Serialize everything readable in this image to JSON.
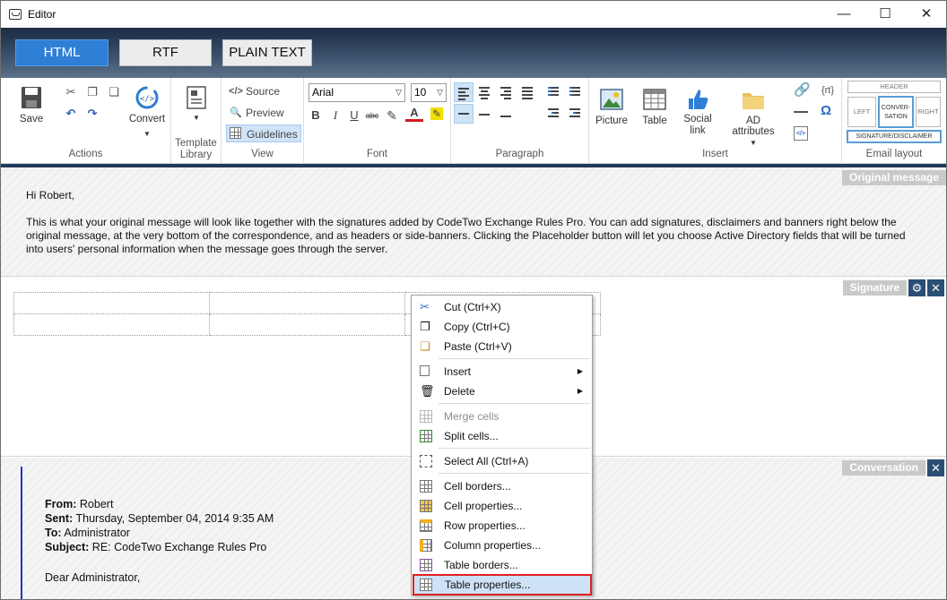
{
  "window": {
    "title": "Editor",
    "minimize": "—",
    "maximize": "☐",
    "close": "✕"
  },
  "mode_tabs": [
    {
      "label": "HTML",
      "active": true
    },
    {
      "label": "RTF",
      "active": false
    },
    {
      "label": "PLAIN TEXT",
      "active": false
    }
  ],
  "ribbon": {
    "actions": {
      "save": "Save",
      "convert": "Convert",
      "group": "Actions"
    },
    "template": {
      "group": "Template Library"
    },
    "view": {
      "source": "Source",
      "preview": "Preview",
      "guidelines": "Guidelines",
      "group": "View"
    },
    "font": {
      "family": "Arial",
      "size": "10",
      "group": "Font"
    },
    "paragraph": {
      "group": "Paragraph"
    },
    "insert": {
      "picture": "Picture",
      "table": "Table",
      "social_link": "Social link",
      "ad_attributes": "AD attributes",
      "rt": "{rt}",
      "omega": "Ω",
      "group": "Insert"
    },
    "email_layout": {
      "header": "HEADER",
      "left": "LEFT",
      "conversation": "CONVER-SATION",
      "right": "RIGHT",
      "signature": "SIGNATURE/DISCLAIMER",
      "group": "Email layout"
    }
  },
  "sections": {
    "original": {
      "tag": "Original message",
      "greeting": "Hi Robert,",
      "body": "This is what your original message will look like together with the signatures added by CodeTwo Exchange Rules Pro. You can add signatures, disclaimers and banners right below the original message, at the very bottom of the correspondence, and as headers or side-banners. Clicking the Placeholder button will let you choose Active Directory fields that will be turned into users' personal information when the message goes through the server."
    },
    "signature": {
      "tag": "Signature"
    },
    "conversation": {
      "tag": "Conversation",
      "from_label": "From:",
      "from": "Robert",
      "sent_label": "Sent:",
      "sent": "Thursday, September 04, 2014 9:35 AM",
      "to_label": "To:",
      "to": "Administrator",
      "subject_label": "Subject:",
      "subject": "RE: CodeTwo Exchange Rules Pro",
      "salutation": "Dear Administrator,"
    }
  },
  "context_menu": {
    "cut": "Cut (Ctrl+X)",
    "copy": "Copy (Ctrl+C)",
    "paste": "Paste (Ctrl+V)",
    "insert": "Insert",
    "delete": "Delete",
    "merge_cells": "Merge cells",
    "split_cells": "Split cells...",
    "select_all": "Select All (Ctrl+A)",
    "cell_borders": "Cell borders...",
    "cell_properties": "Cell properties...",
    "row_properties": "Row properties...",
    "column_properties": "Column properties...",
    "table_borders": "Table borders...",
    "table_properties": "Table properties..."
  },
  "colors": {
    "accent": "#2f7fd7",
    "tab_bg": "#1b2c44",
    "tag": "#c9c9c9",
    "tag_button": "#2b4e74",
    "highlight_border": "#e02020"
  }
}
